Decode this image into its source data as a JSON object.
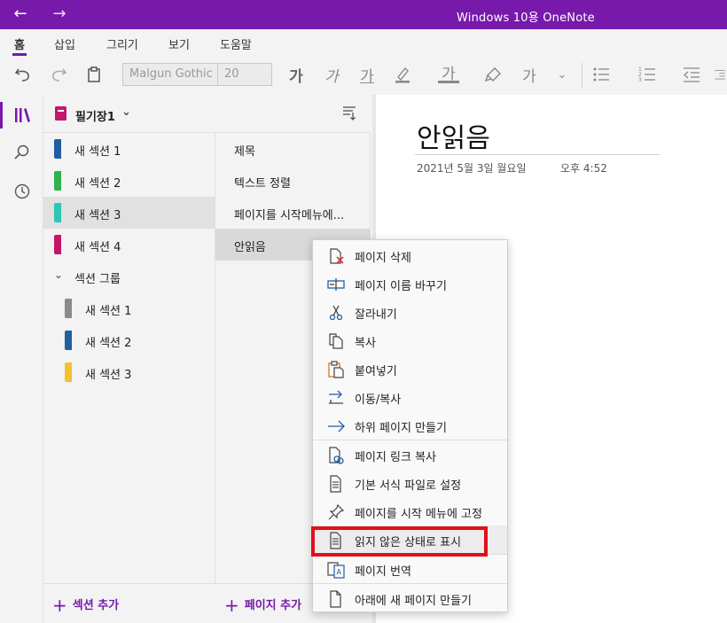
{
  "titlebar": {
    "title": "Windows 10용 OneNote",
    "back": "←",
    "forward": "→"
  },
  "ribbon_tabs": [
    "홈",
    "삽입",
    "그리기",
    "보기",
    "도움말"
  ],
  "toolbar": {
    "font_name": "Malgun Gothic",
    "font_size": "20",
    "bold": "가",
    "italic": "가",
    "underline": "가",
    "font_color": "가",
    "styles": "가"
  },
  "notebook": {
    "name": "필기장1"
  },
  "sections": [
    {
      "label": "새 섹션 1",
      "color": "#1f5fa0"
    },
    {
      "label": "새 섹션 2",
      "color": "#2fb24a"
    },
    {
      "label": "새 섹션 3",
      "color": "#2ec4b6"
    },
    {
      "label": "새 섹션 4",
      "color": "#c4176c"
    }
  ],
  "section_group": {
    "label": "섹션 그룹",
    "sections": [
      {
        "label": "새 섹션 1",
        "color": "#8a8a8a"
      },
      {
        "label": "새 섹션 2",
        "color": "#1f5fa0"
      },
      {
        "label": "새 섹션 3",
        "color": "#f2c12e"
      }
    ]
  },
  "pages": [
    "제목",
    "텍스트 정렬",
    "페이지를 시작메뉴에...",
    "안읽음"
  ],
  "add_section": "섹션 추가",
  "add_page": "페이지 추가",
  "canvas": {
    "title": "안읽음",
    "date": "2021년 5월 3일 월요일",
    "time": "오후 4:52"
  },
  "context_menu": [
    "페이지 삭제",
    "페이지 이름 바꾸기",
    "잘라내기",
    "복사",
    "붙여넣기",
    "이동/복사",
    "하위 페이지 만들기",
    "페이지 링크 복사",
    "기본 서식 파일로 설정",
    "페이지를 시작 메뉴에 고정",
    "읽지 않은 상태로 표시",
    "페이지 번역",
    "아래에 새 페이지 만들기"
  ],
  "colors": {
    "accent": "#7719aa",
    "highlight_box": "#e0101a"
  }
}
